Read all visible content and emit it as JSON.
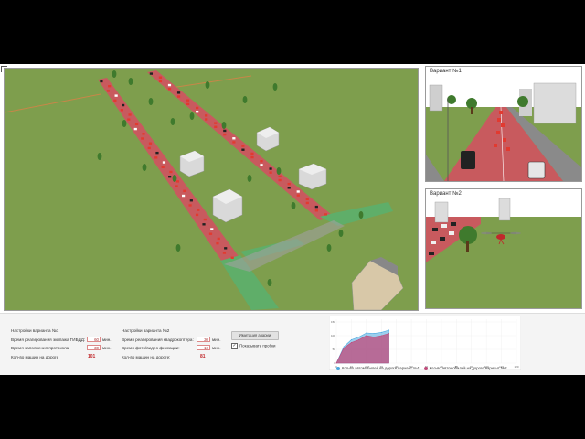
{
  "views": {
    "variant1_title": "Вариант №1",
    "variant2_title": "Вариант №2"
  },
  "settings1": {
    "title": "Настройки варианта №1",
    "rows": [
      {
        "label": "Время реагирования экипажа ГИБДД:",
        "value": "60",
        "unit": "мин."
      },
      {
        "label": "Время заполнения протокола",
        "value": "30",
        "unit": "мин."
      }
    ],
    "count_label": "Кол-во машин на дороге",
    "count_value": "101"
  },
  "settings2": {
    "title": "Настройки варианта №2",
    "rows": [
      {
        "label": "Время реагирования квадрокоптера:",
        "value": "30",
        "unit": "мин."
      },
      {
        "label": "Время фото/видео фиксации:",
        "value": "10",
        "unit": "мин."
      }
    ],
    "count_label": "Кол-во машин на дороге:",
    "count_value": "81"
  },
  "controls": {
    "button_label": "Имитация аварии",
    "checkbox_label": "Показывать пробки",
    "checkbox_checked": true
  },
  "chart_data": {
    "type": "area",
    "x": [
      0,
      5,
      10,
      15,
      20,
      25,
      30,
      35,
      40,
      45,
      50,
      55,
      60,
      65,
      70,
      75,
      80,
      85,
      90,
      95,
      100,
      105,
      110,
      115,
      120
    ],
    "xlim": [
      0,
      120
    ],
    "ylim": [
      0,
      160
    ],
    "x_tick_labels": [
      "0",
      "10",
      "20",
      "30",
      "40",
      "50",
      "60",
      "70",
      "80",
      "90",
      "100",
      "110",
      "120"
    ],
    "y_tick_labels": [
      "0",
      "50",
      "100",
      "150"
    ],
    "series": [
      {
        "name": "Кол-во автомобилей на дороге вариант №1",
        "color": "#4aa8e0",
        "values": [
          0,
          60,
          85,
          95,
          110,
          108,
          112,
          120,
          null,
          null,
          null,
          null,
          null,
          null,
          null,
          null,
          null,
          null,
          null,
          null,
          null,
          null,
          null,
          null,
          null
        ]
      },
      {
        "name": "Кол-во автомобилей на дороге вариант №2",
        "color": "#c04a7a",
        "values": [
          0,
          55,
          75,
          85,
          100,
          95,
          100,
          108,
          null,
          null,
          null,
          null,
          null,
          null,
          null,
          null,
          null,
          null,
          null,
          null,
          null,
          null,
          null,
          null,
          null
        ]
      }
    ]
  },
  "colors": {
    "grass": "#7e9e4d",
    "road": "#c85a5e",
    "traffic_car": "#e23a30",
    "bike_lane": "#5fae69",
    "sky": "#ffffff",
    "accent_count": "#c0282b"
  }
}
